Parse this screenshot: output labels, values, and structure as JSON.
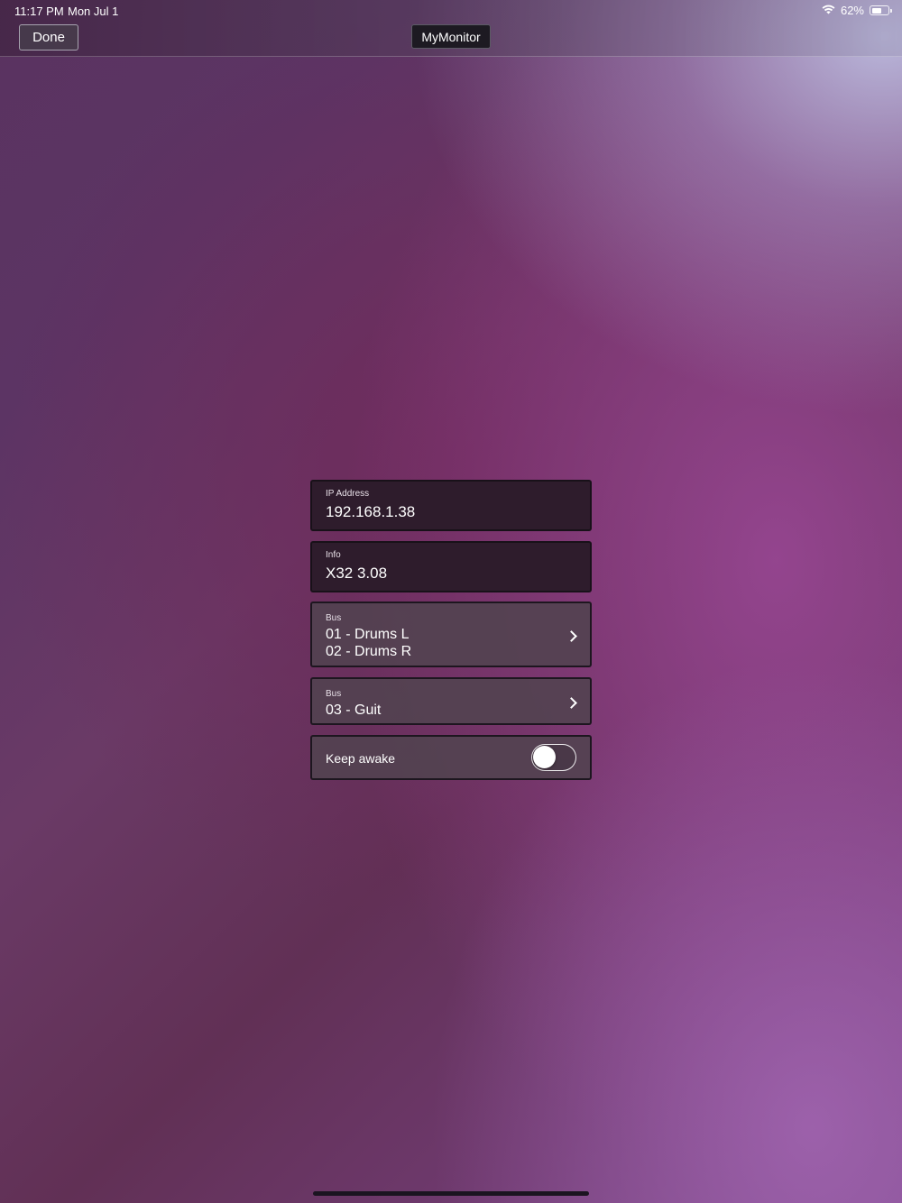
{
  "status_bar": {
    "time": "11:17 PM",
    "date": "Mon Jul 1",
    "battery_percent": "62%",
    "battery_level": 0.62
  },
  "nav": {
    "done_label": "Done",
    "title": "MyMonitor"
  },
  "form": {
    "ip": {
      "label": "IP Address",
      "value": "192.168.1.38"
    },
    "info": {
      "label": "Info",
      "value": "X32 3.08"
    },
    "bus1": {
      "label": "Bus",
      "line1": "01 - Drums L",
      "line2": "02 - Drums R"
    },
    "bus2": {
      "label": "Bus",
      "value": "03 - Guit"
    },
    "keep_awake": {
      "label": "Keep awake",
      "on": false
    }
  },
  "icons": {
    "wifi": "wifi-icon",
    "battery": "battery-icon",
    "chevron": "chevron-right-icon"
  },
  "colors": {
    "panel_dark": "#2e1c2c",
    "panel_light": "#524250",
    "title_pill": "#1d1a22"
  }
}
